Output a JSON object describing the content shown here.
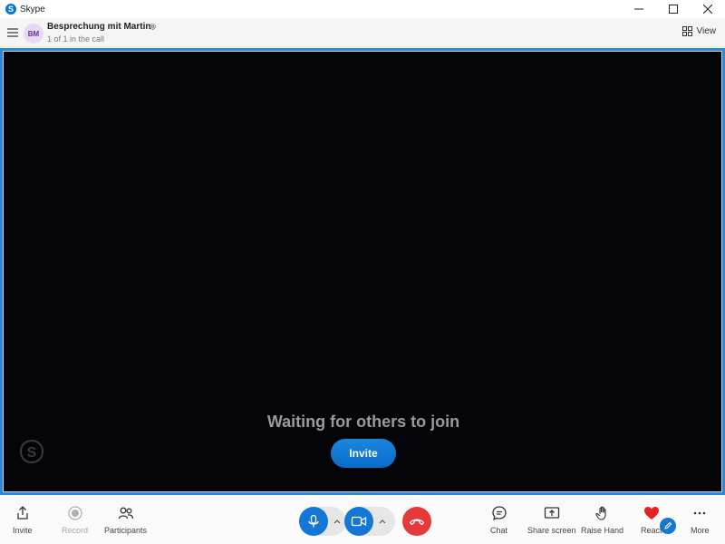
{
  "window": {
    "app_title": "Skype"
  },
  "header": {
    "avatar_initials": "BM",
    "conversation_title": "Besprechung mit Martin",
    "subtitle": "1 of 1 in the call",
    "view_label": "View"
  },
  "stage": {
    "waiting_text": "Waiting for others to join",
    "invite_label": "Invite"
  },
  "toolbar": {
    "invite_label": "Invite",
    "record_label": "Record",
    "participants_label": "Participants",
    "chat_label": "Chat",
    "share_screen_label": "Share screen",
    "raise_hand_label": "Raise Hand",
    "react_label": "React",
    "more_label": "More"
  },
  "colors": {
    "accent_blue": "#1477d4",
    "hangup_red": "#e63a3a",
    "stage_border": "#2b88d8",
    "stage_bg": "#050509"
  },
  "icons": [
    "skype-logo-icon",
    "minimize-icon",
    "maximize-icon",
    "close-icon",
    "menu-icon",
    "settings-icon",
    "grid-view-icon",
    "share-icon",
    "record-icon",
    "participants-icon",
    "microphone-icon",
    "chevron-up-icon",
    "video-camera-icon",
    "hang-up-icon",
    "chat-icon",
    "share-screen-icon",
    "raise-hand-icon",
    "heart-icon",
    "pen-icon",
    "more-icon"
  ]
}
